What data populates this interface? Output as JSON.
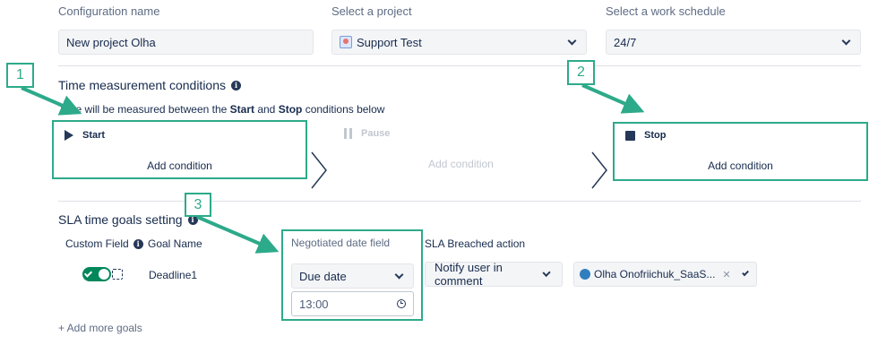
{
  "config": {
    "name_label": "Configuration name",
    "name_value": "New project Olha",
    "project_label": "Select a project",
    "project_value": "Support Test",
    "schedule_label": "Select a work schedule",
    "schedule_value": "24/7"
  },
  "time_measurement": {
    "title": "Time measurement conditions",
    "subtitle_prefix": "Time will be measured between the ",
    "subtitle_start": "Start",
    "subtitle_and": " and ",
    "subtitle_stop": "Stop",
    "subtitle_suffix": " conditions below",
    "start_label": "Start",
    "pause_label": "Pause",
    "stop_label": "Stop",
    "add_condition": "Add condition"
  },
  "sla": {
    "title": "SLA time goals setting",
    "custom_field_header": "Custom Field",
    "goal_name_header": "Goal Name",
    "negotiated_header": "Negotiated date field",
    "breached_header": "SLA Breached action",
    "goal_name_value": "Deadline1",
    "date_field_value": "Due date",
    "time_value": "13:00",
    "breached_action_value": "Notify user in comment",
    "user_value": "Olha Onofriichuk_SaaS...",
    "add_more": "+ Add more goals"
  },
  "callouts": [
    "1",
    "2",
    "3"
  ],
  "colors": {
    "accent": "#2daa8a",
    "toggle": "#00875a",
    "text": "#172b4d",
    "muted": "#5e6c84",
    "disabled": "#c1c7d0"
  }
}
